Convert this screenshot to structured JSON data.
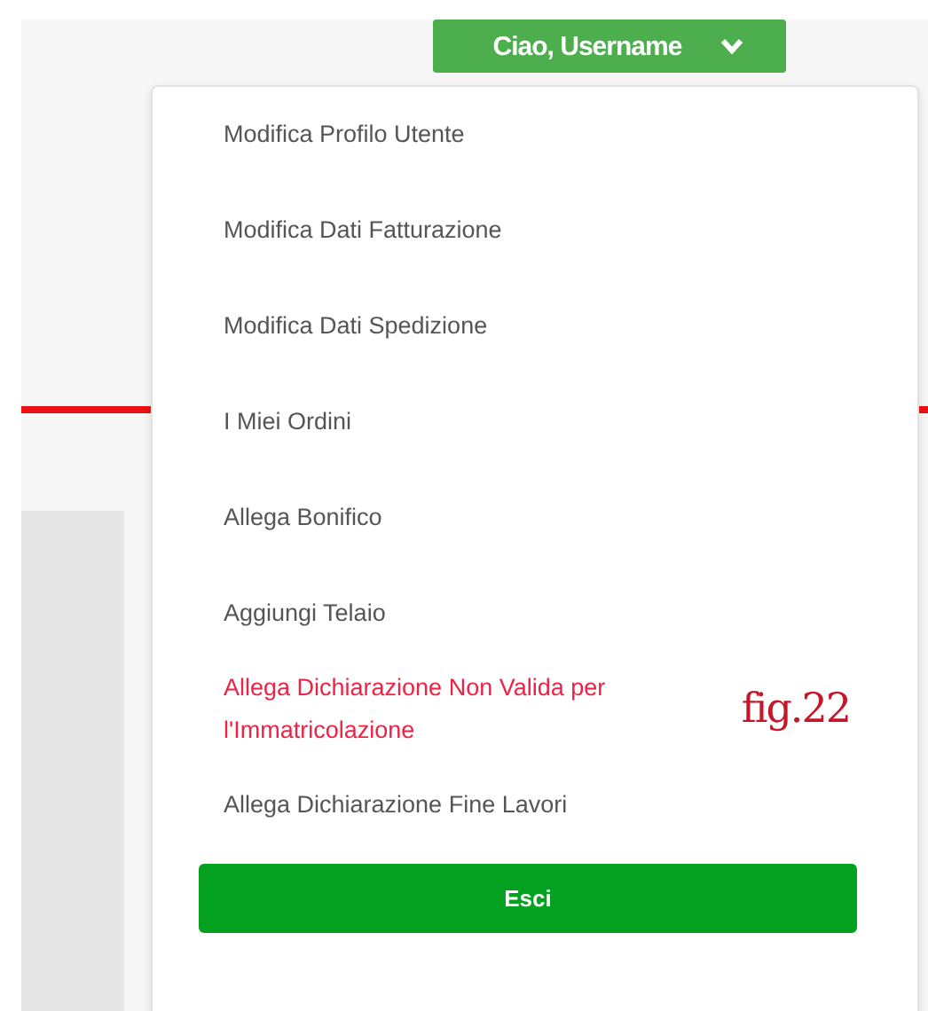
{
  "user_button": {
    "label": "Ciao, Username",
    "expanded": true
  },
  "menu": {
    "items": [
      {
        "label": "Modifica Profilo Utente",
        "alert": false
      },
      {
        "label": "Modifica Dati Fatturazione",
        "alert": false
      },
      {
        "label": "Modifica Dati Spedizione",
        "alert": false
      },
      {
        "label": "I Miei Ordini",
        "alert": false
      },
      {
        "label": "Allega Bonifico",
        "alert": false
      },
      {
        "label": "Aggiungi Telaio",
        "alert": false
      },
      {
        "label": "Allega Dichiarazione Non Valida per l'Immatricolazione",
        "alert": true,
        "note": "fig.22"
      },
      {
        "label": "Allega Dichiarazione Fine Lavori",
        "alert": false
      }
    ],
    "logout_button": "Esci"
  }
}
